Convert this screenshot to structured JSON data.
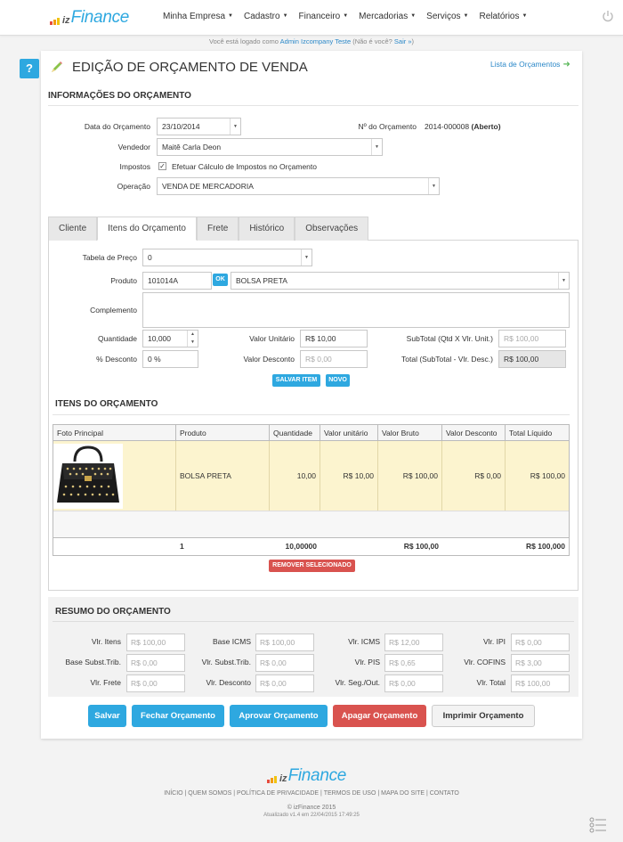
{
  "brand": {
    "prefix": "iz",
    "name": "Finance"
  },
  "nav": [
    {
      "label": "Minha Empresa"
    },
    {
      "label": "Cadastro"
    },
    {
      "label": "Financeiro"
    },
    {
      "label": "Mercadorias"
    },
    {
      "label": "Serviços"
    },
    {
      "label": "Relatórios"
    }
  ],
  "login": {
    "prefix": "Você está logado como ",
    "user": "Admin Izcompany Teste",
    "middle": " (Não é você? ",
    "logout": "Sair »",
    "suffix": ")"
  },
  "header": {
    "help": "?",
    "title": "EDIÇÃO DE ORÇAMENTO DE VENDA",
    "list_link": "Lista de Orçamentos"
  },
  "info": {
    "section_title": "INFORMAÇÕES DO ORÇAMENTO",
    "date_label": "Data do Orçamento",
    "date_value": "23/10/2014",
    "number_label": "Nº do Orçamento",
    "number_value": "2014-000008",
    "status": "(Aberto)",
    "seller_label": "Vendedor",
    "seller_value": "Maitê Carla Deon",
    "taxes_label": "Impostos",
    "taxes_check": "Efetuar Cálculo de Impostos no Orçamento",
    "operation_label": "Operação",
    "operation_value": "VENDA DE MERCADORIA"
  },
  "tabs": [
    {
      "label": "Cliente"
    },
    {
      "label": "Itens do Orçamento"
    },
    {
      "label": "Frete"
    },
    {
      "label": "Histórico"
    },
    {
      "label": "Observações"
    }
  ],
  "item_form": {
    "price_table_label": "Tabela de Preço",
    "price_table_value": "0",
    "product_label": "Produto",
    "product_code": "101014A",
    "ok": "OK",
    "product_name": "BOLSA PRETA",
    "complement_label": "Complemento",
    "qty_label": "Quantidade",
    "qty_value": "10,000",
    "unit_label": "Valor Unitário",
    "unit_value": "R$ 10,00",
    "subtotal_label": "SubTotal (Qtd X Vlr. Unit.)",
    "subtotal_value": "R$ 100,00",
    "discount_pct_label": "% Desconto",
    "discount_pct_value": "0 %",
    "discount_value_label": "Valor Desconto",
    "discount_value": "R$ 0,00",
    "total_label": "Total (SubTotal - Vlr. Desc.)",
    "total_value": "R$ 100,00",
    "save_item": "SALVAR ITEM",
    "new": "NOVO"
  },
  "items": {
    "section_title": "ITENS DO ORÇAMENTO",
    "columns": [
      "Foto Principal",
      "Produto",
      "Quantidade",
      "Valor unitário",
      "Valor Bruto",
      "Valor Desconto",
      "Total Líquido"
    ],
    "rows": [
      {
        "product": "BOLSA PRETA",
        "qty": "10,00",
        "unit": "R$ 10,00",
        "gross": "R$ 100,00",
        "discount": "R$ 0,00",
        "net": "R$ 100,00"
      }
    ],
    "totals": {
      "count": "1",
      "qty": "10,00000",
      "gross": "R$ 100,00",
      "net": "R$ 100,000"
    },
    "remove": "REMOVER SELECIONADO"
  },
  "summary": {
    "section_title": "RESUMO DO ORÇAMENTO",
    "fields": [
      {
        "label": "Vlr. Itens",
        "value": "R$ 100,00"
      },
      {
        "label": "Base ICMS",
        "value": "R$ 100,00"
      },
      {
        "label": "Vlr. ICMS",
        "value": "R$ 12,00"
      },
      {
        "label": "Vlr. IPI",
        "value": "R$ 0,00"
      },
      {
        "label": "Base Subst.Trib.",
        "value": "R$ 0,00"
      },
      {
        "label": "Vlr. Subst.Trib.",
        "value": "R$ 0,00"
      },
      {
        "label": "Vlr. PIS",
        "value": "R$ 0,65"
      },
      {
        "label": "Vlr. COFINS",
        "value": "R$ 3,00"
      },
      {
        "label": "Vlr. Frete",
        "value": "R$ 0,00"
      },
      {
        "label": "Vlr. Desconto",
        "value": "R$ 0,00"
      },
      {
        "label": "Vlr. Seg./Out.",
        "value": "R$ 0,00"
      },
      {
        "label": "Vlr. Total",
        "value": "R$ 100,00"
      }
    ]
  },
  "actions": {
    "save": "Salvar",
    "close": "Fechar Orçamento",
    "approve": "Aprovar Orçamento",
    "delete": "Apagar Orçamento",
    "print": "Imprimir Orçamento"
  },
  "footer": {
    "links": [
      "INÍCIO",
      "QUEM SOMOS",
      "POLÍTICA DE PRIVACIDADE",
      "TERMOS DE USO",
      "MAPA DO SITE",
      "CONTATO"
    ],
    "copyright": "© izFinance 2015",
    "version": "Atualizado v1.4 em 22/04/2015 17:49:25"
  },
  "colors": {
    "accent": "#2ea8e0",
    "danger": "#d9534f",
    "highlight_row": "#fcf4cf"
  }
}
